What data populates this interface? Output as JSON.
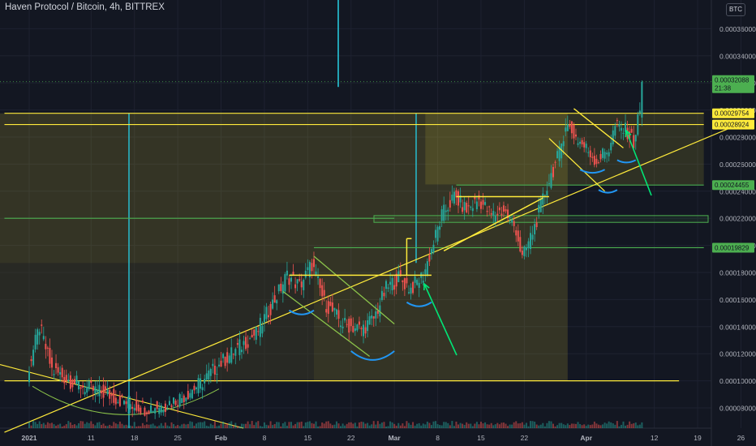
{
  "title": "Haven Protocol / Bitcoin, 4h, BITTREX",
  "currency_button": "BTC",
  "colors": {
    "background": "#131722",
    "grid": "#1e2230",
    "candle_up": "#26a69a",
    "candle_down": "#ef5350",
    "annotation_yellow": "#ffeb3b",
    "annotation_cyan": "#26c6da",
    "annotation_green": "#4caf50",
    "arrow_green": "#00e676",
    "cup_blue": "#2196f3",
    "price_tag_green": "#4caf50",
    "price_tag_yellow": "#ffeb3b"
  },
  "chart_data": {
    "type": "candlestick",
    "pair": "XHV/BTC",
    "timeframe": "4h",
    "exchange": "BITTREX",
    "x_tick_labels": [
      "2021",
      "11",
      "18",
      "25",
      "Feb",
      "8",
      "15",
      "22",
      "Mar",
      "8",
      "15",
      "22",
      "Apr",
      "12",
      "19",
      "26"
    ],
    "y_tick_labels": [
      "0.00036000",
      "0.00034000",
      "0.00032000",
      "0.00030000",
      "0.00028000",
      "0.00026000",
      "0.00024000",
      "0.00022000",
      "0.00020000",
      "0.00018000",
      "0.00016000",
      "0.00014000",
      "0.00012000",
      "0.00010000",
      "0.00008000"
    ],
    "ylim": [
      6.5e-05,
      0.00038
    ],
    "price_series": [
      [
        "2021-01-01",
        0.000105
      ],
      [
        "2021-01-03",
        0.00014
      ],
      [
        "2021-01-05",
        0.000108
      ],
      [
        "2021-01-08",
        0.0001
      ],
      [
        "2021-01-11",
        9.4e-05
      ],
      [
        "2021-01-14",
        9e-05
      ],
      [
        "2021-01-17",
        8.4e-05
      ],
      [
        "2021-01-20",
        8e-05
      ],
      [
        "2021-01-23",
        8.2e-05
      ],
      [
        "2021-01-26",
        8.8e-05
      ],
      [
        "2021-01-29",
        9.8e-05
      ],
      [
        "2021-02-01",
        0.000112
      ],
      [
        "2021-02-04",
        0.000124
      ],
      [
        "2021-02-07",
        0.000135
      ],
      [
        "2021-02-10",
        0.00016
      ],
      [
        "2021-02-12",
        0.000178
      ],
      [
        "2021-02-14",
        0.00017
      ],
      [
        "2021-02-16",
        0.000186
      ],
      [
        "2021-02-18",
        0.000158
      ],
      [
        "2021-02-21",
        0.000142
      ],
      [
        "2021-02-24",
        0.000138
      ],
      [
        "2021-02-26",
        0.000146
      ],
      [
        "2021-02-28",
        0.000168
      ],
      [
        "2021-03-02",
        0.000176
      ],
      [
        "2021-03-04",
        0.000168
      ],
      [
        "2021-03-06",
        0.000178
      ],
      [
        "2021-03-07",
        0.000192
      ],
      [
        "2021-03-09",
        0.000222
      ],
      [
        "2021-03-11",
        0.000236
      ],
      [
        "2021-03-13",
        0.000226
      ],
      [
        "2021-03-15",
        0.000234
      ],
      [
        "2021-03-17",
        0.000222
      ],
      [
        "2021-03-19",
        0.000226
      ],
      [
        "2021-03-21",
        0.000212
      ],
      [
        "2021-03-22",
        0.00019
      ],
      [
        "2021-03-24",
        0.000214
      ],
      [
        "2021-03-26",
        0.000244
      ],
      [
        "2021-03-28",
        0.000268
      ],
      [
        "2021-03-29",
        0.00029
      ],
      [
        "2021-03-31",
        0.000278
      ],
      [
        "2021-04-02",
        0.000268
      ],
      [
        "2021-04-03",
        0.000262
      ],
      [
        "2021-04-05",
        0.000272
      ],
      [
        "2021-04-06",
        0.000288
      ],
      [
        "2021-04-08",
        0.000284
      ],
      [
        "2021-04-09",
        0.000276
      ],
      [
        "2021-04-10",
        0.0003
      ],
      [
        "2021-04-10",
        0.00032
      ]
    ],
    "price_tags": [
      {
        "value": "0.00032088",
        "sub": "21:38",
        "style": "green"
      },
      {
        "value": "0.00029754",
        "style": "yellow"
      },
      {
        "value": "0.00028924",
        "style": "yellow"
      },
      {
        "value": "0.00024455",
        "style": "green"
      },
      {
        "value": "0.00019829",
        "style": "green"
      }
    ],
    "horizontal_levels": [
      {
        "y": 0.00029754,
        "x_start": "2020-12-28",
        "x_end": "2021-04-20",
        "color": "yellow"
      },
      {
        "y": 0.00028924,
        "x_start": "2020-12-28",
        "x_end": "2021-04-20",
        "color": "yellow"
      },
      {
        "y": 0.0001,
        "x_start": "2020-12-28",
        "x_end": "2021-04-16",
        "color": "yellow"
      },
      {
        "y": 0.00022,
        "x_start": "2020-12-28",
        "x_end": "2021-03-01",
        "color": "green"
      },
      {
        "y": 0.00024455,
        "x_start": "2021-03-11",
        "x_end": "2021-04-20",
        "color": "green"
      },
      {
        "y": 0.00019829,
        "x_start": "2021-02-16",
        "x_end": "2021-04-20",
        "color": "green"
      }
    ],
    "trendline": {
      "from": [
        "2020-12-28",
        6.2e-05
      ],
      "to": [
        "2021-04-27",
        0.000292
      ]
    },
    "bull_flags": [
      {
        "upper": [
          [
            "2021-02-16",
            0.000192
          ],
          [
            "2021-03-01",
            0.000142
          ]
        ],
        "lower": [
          [
            "2021-02-11",
            0.000166
          ],
          [
            "2021-02-25",
            0.000118
          ]
        ]
      },
      {
        "upper": [
          [
            "2021-03-30",
            0.000301
          ],
          [
            "2021-04-07",
            0.000272
          ]
        ],
        "lower": [
          [
            "2021-03-26",
            0.000279
          ],
          [
            "2021-04-04",
            0.00024
          ]
        ]
      }
    ],
    "notes": "Yellow consolidation rectangles, cup-and-handle arcs and green arrows mark retests of the rising trendline."
  }
}
